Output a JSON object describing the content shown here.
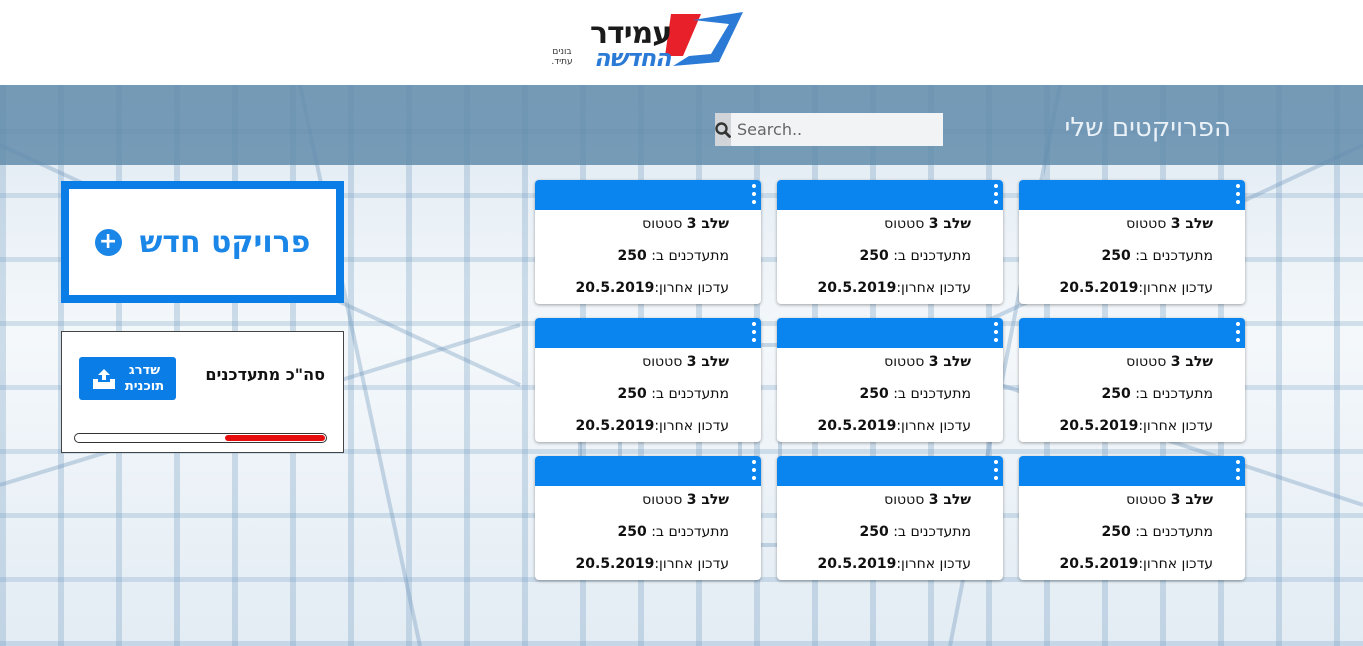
{
  "logo": {
    "line1": "עמידר",
    "line2": "החדשה",
    "small1": "בונים",
    "small2": "עתיד."
  },
  "header": {
    "title": "הפרויקטים שלי",
    "search_placeholder": "Search.."
  },
  "new_project": {
    "label": "פרויקט חדש",
    "plus": "+"
  },
  "subscribers": {
    "label": "סה\"כ מתעדכנים",
    "upgrade_line1": "שדרג",
    "upgrade_line2": "תוכנית",
    "progress_fraction": 0.4
  },
  "colors": {
    "accent": "#0a85f0",
    "progress": "#e50d0d",
    "header": "#628cac"
  },
  "cards": [
    {
      "stage_label": "שלב 3",
      "status": "סטטוס",
      "subs_label": "מתעדכנים ב:",
      "subs_value": "250",
      "updated_label": "עדכון אחרון:",
      "updated_value": "20.5.2019"
    },
    {
      "stage_label": "שלב 3",
      "status": "סטטוס",
      "subs_label": "מתעדכנים ב:",
      "subs_value": "250",
      "updated_label": "עדכון אחרון:",
      "updated_value": "20.5.2019"
    },
    {
      "stage_label": "שלב 3",
      "status": "סטטוס",
      "subs_label": "מתעדכנים ב:",
      "subs_value": "250",
      "updated_label": "עדכון אחרון:",
      "updated_value": "20.5.2019"
    },
    {
      "stage_label": "שלב 3",
      "status": "סטטוס",
      "subs_label": "מתעדכנים ב:",
      "subs_value": "250",
      "updated_label": "עדכון אחרון:",
      "updated_value": "20.5.2019"
    },
    {
      "stage_label": "שלב 3",
      "status": "סטטוס",
      "subs_label": "מתעדכנים ב:",
      "subs_value": "250",
      "updated_label": "עדכון אחרון:",
      "updated_value": "20.5.2019"
    },
    {
      "stage_label": "שלב 3",
      "status": "סטטוס",
      "subs_label": "מתעדכנים ב:",
      "subs_value": "250",
      "updated_label": "עדכון אחרון:",
      "updated_value": "20.5.2019"
    },
    {
      "stage_label": "שלב 3",
      "status": "סטטוס",
      "subs_label": "מתעדכנים ב:",
      "subs_value": "250",
      "updated_label": "עדכון אחרון:",
      "updated_value": "20.5.2019"
    },
    {
      "stage_label": "שלב 3",
      "status": "סטטוס",
      "subs_label": "מתעדכנים ב:",
      "subs_value": "250",
      "updated_label": "עדכון אחרון:",
      "updated_value": "20.5.2019"
    },
    {
      "stage_label": "שלב 3",
      "status": "סטטוס",
      "subs_label": "מתעדכנים ב:",
      "subs_value": "250",
      "updated_label": "עדכון אחרון:",
      "updated_value": "20.5.2019"
    }
  ]
}
